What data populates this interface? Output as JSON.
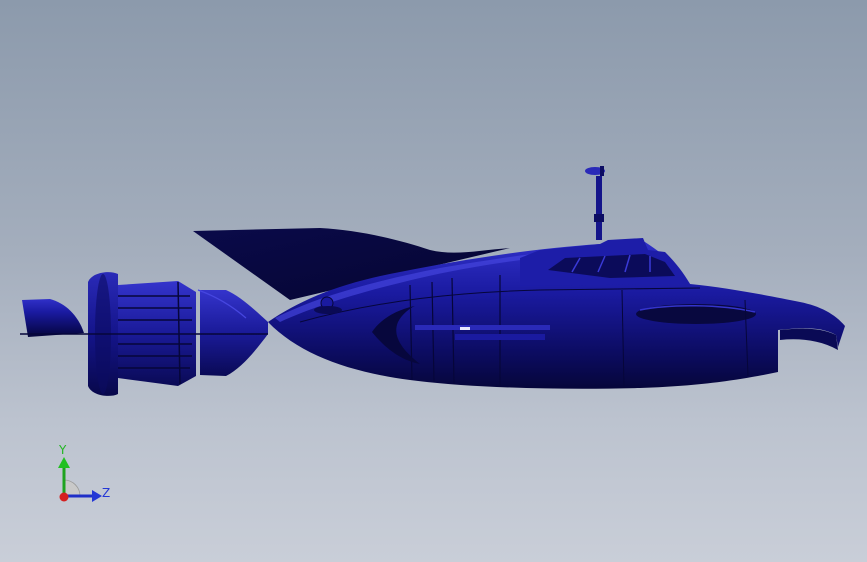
{
  "viewport": {
    "background_top": "#8c9aac",
    "background_bottom": "#c9ced8"
  },
  "model": {
    "name": "submarine-side-view",
    "color": "#12127a",
    "highlight_color": "#3a3ad8",
    "shadow_color": "#07073d"
  },
  "triad": {
    "y_label": "Y",
    "z_label": "Z",
    "y_color": "#22b622",
    "z_color": "#2437d6",
    "x_color": "#d42020"
  }
}
